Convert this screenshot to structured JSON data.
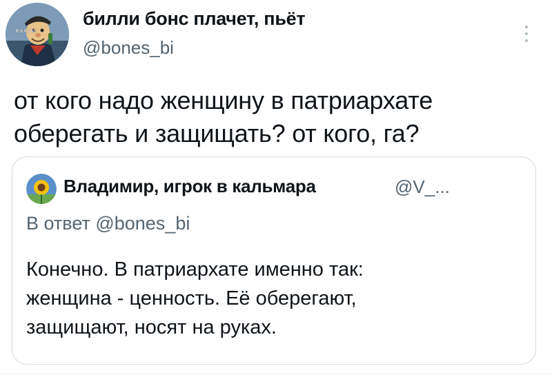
{
  "tweet": {
    "author": {
      "display_name": "билли бонс плачет, пьёт",
      "handle": "@bones_bi",
      "avatar_icon": "avatar-cartoon-sailor-icon",
      "avatar_caption": "вахуи"
    },
    "text_line_1": "от кого надо женщину в патриархате",
    "text_line_2": "оберегать и защищать? от кого, га?",
    "more_icon": "more-vertical-icon"
  },
  "quote": {
    "author": {
      "display_name": "Владимир, игрок в кальмара",
      "handle": "@V_...",
      "avatar_icon": "sunflower-avatar-icon"
    },
    "reply_prefix": "В ответ",
    "reply_handle": "@bones_bi",
    "text_line_1": "Конечно. В патриархате именно так:",
    "text_line_2": "женщина - ценность. Её оберегают,",
    "text_line_3": "защищают, носят на руках."
  },
  "colors": {
    "primary_text": "#0f1419",
    "secondary_text": "#536471",
    "border": "#cfd9de",
    "background": "#ffffff"
  }
}
